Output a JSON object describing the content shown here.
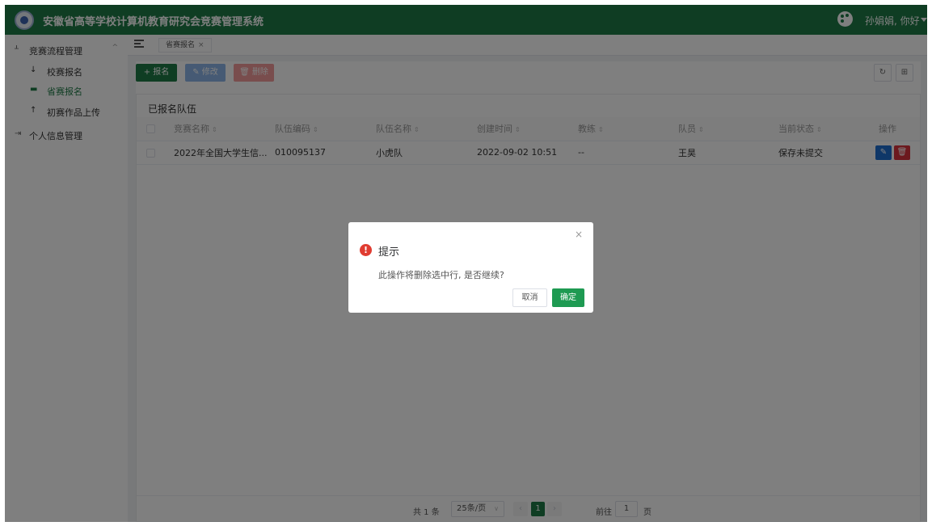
{
  "header": {
    "title": "安徽省高等学校计算机教育研究会竞赛管理系统",
    "user_greeting": "孙娟娟, 你好",
    "theme_icon": "palette-icon",
    "brand_color": "#1e7a46"
  },
  "sidebar": {
    "group_label": "竞赛流程管理",
    "items": [
      {
        "label": "校赛报名",
        "icon": "arrow-down-icon"
      },
      {
        "label": "省赛报名",
        "icon": "table-icon",
        "active": true
      },
      {
        "label": "初赛作品上传",
        "icon": "arrow-up-icon"
      }
    ],
    "group2_label": "个人信息管理"
  },
  "tabs": [
    {
      "label": "省赛报名",
      "close": "×"
    }
  ],
  "toolbar": {
    "add_label": "+ 报名",
    "edit_label": "✎ 修改",
    "delete_label": "🗑 删除"
  },
  "panel": {
    "title": "已报名队伍"
  },
  "table": {
    "columns": [
      "竞赛名称",
      "队伍编码",
      "队伍名称",
      "创建时间",
      "教练",
      "队员",
      "当前状态",
      "操作"
    ],
    "rows": [
      {
        "competition": "2022年全国大学生信...",
        "team_code": "010095137",
        "team_name": "小虎队",
        "created": "2022-09-02 10:51",
        "coach": "--",
        "members": "王昊",
        "status": "保存未提交"
      }
    ]
  },
  "pagination": {
    "total": "共 1 条",
    "page_size": "25条/页",
    "current_page": "1",
    "goto_label": "前往",
    "goto_value": "1",
    "page_suffix": "页"
  },
  "dialog": {
    "title": "提示",
    "message": "此操作将删除选中行, 是否继续?",
    "cancel_label": "取消",
    "confirm_label": "确定",
    "close_label": "×"
  }
}
